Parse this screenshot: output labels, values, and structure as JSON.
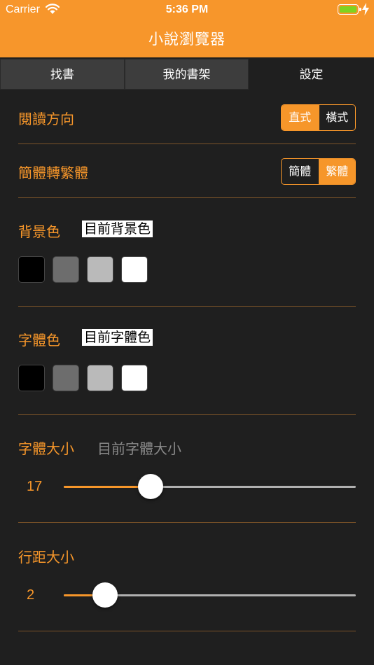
{
  "status_bar": {
    "carrier": "Carrier",
    "time": "5:36 PM",
    "battery_color": "#7ed321"
  },
  "nav": {
    "title": "小說瀏覽器",
    "bar_color": "#f7962b"
  },
  "tabs": [
    {
      "label": "找書",
      "active": false
    },
    {
      "label": "我的書架",
      "active": false
    },
    {
      "label": "設定",
      "active": true
    }
  ],
  "settings": {
    "reading_direction": {
      "label": "閱讀方向",
      "options": [
        "直式",
        "橫式"
      ],
      "selected": "直式"
    },
    "conversion": {
      "label": "簡體轉繁體",
      "options": [
        "簡體",
        "繁體"
      ],
      "selected": "繁體"
    },
    "background_color": {
      "label": "背景色",
      "current_label": "目前背景色",
      "swatches": [
        "#000000",
        "#6d6d6d",
        "#bababa",
        "#ffffff"
      ]
    },
    "font_color": {
      "label": "字體色",
      "current_label": "目前字體色",
      "swatches": [
        "#000000",
        "#6d6d6d",
        "#bababa",
        "#ffffff"
      ]
    },
    "font_size": {
      "label": "字體大小",
      "current_label": "目前字體大小",
      "value": "17",
      "fraction": 0.298
    },
    "line_spacing": {
      "label": "行距大小",
      "value": "2",
      "fraction": 0.142
    }
  },
  "colors": {
    "accent": "#f6962a",
    "background": "#1f1f1f"
  }
}
